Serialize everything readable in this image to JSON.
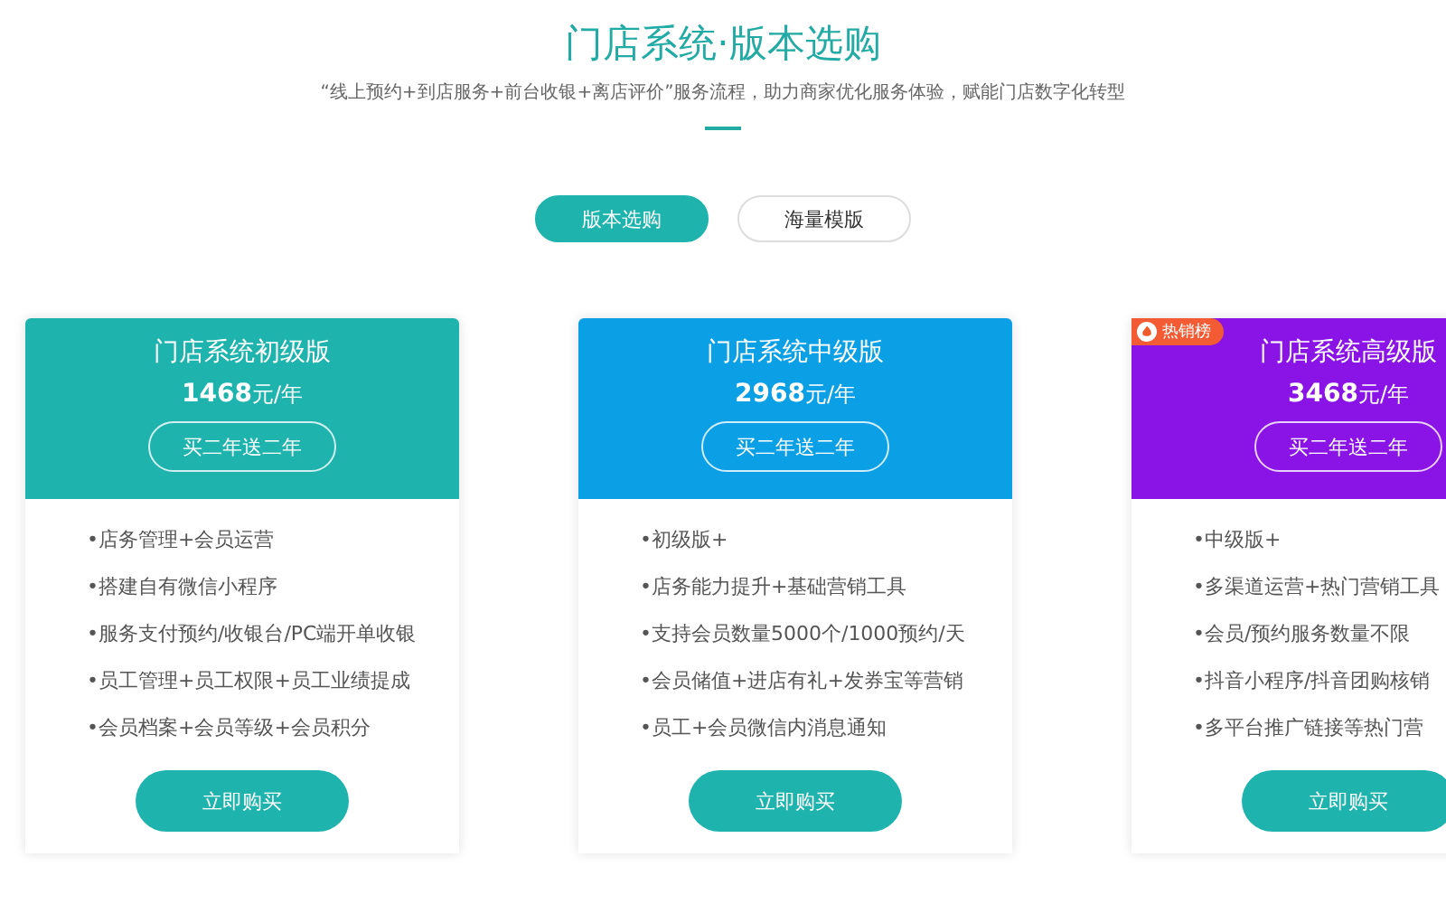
{
  "header": {
    "title": "门店系统·版本选购",
    "subtitle": "“线上预约+到店服务+前台收银+离店评价”服务流程，助力商家优化服务体验，赋能门店数字化转型"
  },
  "tabs": [
    {
      "label": "版本选购",
      "selected": true
    },
    {
      "label": "海量模版",
      "selected": false
    }
  ],
  "plans": [
    {
      "name": "门店系统初级版",
      "price": "1468",
      "unit": "元/年",
      "promo": "买二年送二年",
      "color": "#1fb3ad",
      "features": [
        "•店务管理+会员运营",
        "•搭建自有微信小程序",
        "•服务支付预约/收银台/PC端开单收银",
        "•员工管理+员工权限+员工业绩提成",
        "•会员档案+会员等级+会员积分"
      ],
      "button": "立即购买"
    },
    {
      "name": "门店系统中级版",
      "price": "2968",
      "unit": "元/年",
      "promo": "买二年送二年",
      "color": "#0b9fe6",
      "features": [
        "•初级版+",
        "•店务能力提升+基础营销工具",
        "•支持会员数量5000个/1000预约/天",
        "•会员储值+进店有礼+发券宝等营销",
        "•员工+会员微信内消息通知"
      ],
      "button": "立即购买"
    },
    {
      "name": "门店系统高级版",
      "price": "3468",
      "unit": "元/年",
      "promo": "买二年送二年",
      "color": "#8a14e6",
      "badge": "热销榜",
      "features": [
        "•中级版+",
        "•多渠道运营+热门营销工具",
        "•会员/预约服务数量不限",
        "•抖音小程序/抖音团购核销",
        "•多平台推广链接等热门营"
      ],
      "button": "立即购买"
    }
  ]
}
